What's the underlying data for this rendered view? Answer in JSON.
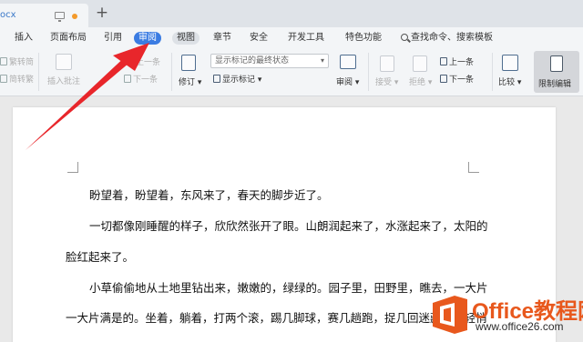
{
  "tabstrip": {
    "doc_tab_name": "ocx",
    "new_tab": "+"
  },
  "menu": {
    "items": [
      {
        "label": "插入"
      },
      {
        "label": "页面布局"
      },
      {
        "label": "引用"
      },
      {
        "label": "审阅"
      },
      {
        "label": "视图"
      },
      {
        "label": "章节"
      },
      {
        "label": "安全"
      },
      {
        "label": "开发工具"
      },
      {
        "label": "特色功能"
      }
    ],
    "search_label": "查找命令、搜索模板"
  },
  "ribbon": {
    "trad_to_simp": "繁转简",
    "simp_to_trad": "简转繁",
    "insert_comment": "插入批注",
    "prev_comment": "上一条",
    "next_comment": "下一条",
    "revise": "修订",
    "markup_select": "显示标记的最终状态",
    "show_markup": "显示标记",
    "review": "审阅",
    "accept": "接受",
    "reject": "拒绝",
    "prev_change": "上一条",
    "next_change": "下一条",
    "compare": "比较",
    "restrict_edit": "限制编辑"
  },
  "document": {
    "paragraphs": [
      "盼望着，盼望着，东风来了，春天的脚步近了。",
      "一切都像刚睡醒的样子，欣欣然张开了眼。山朗润起来了，水涨起来了，太阳的",
      "脸红起来了。",
      "小草偷偷地从土地里钻出来，嫩嫩的，绿绿的。园子里，田野里，瞧去，一大片",
      "一大片满是的。坐着，躺着，打两个滚，踢几脚球，赛几趟跑，捉几回迷藏。风轻悄"
    ]
  },
  "watermark": {
    "brand": "Office教程网",
    "url": "www.office26.com"
  },
  "colors": {
    "accent": "#3b7ce2",
    "arrow": "#e8262b",
    "brand": "#e8581d"
  }
}
